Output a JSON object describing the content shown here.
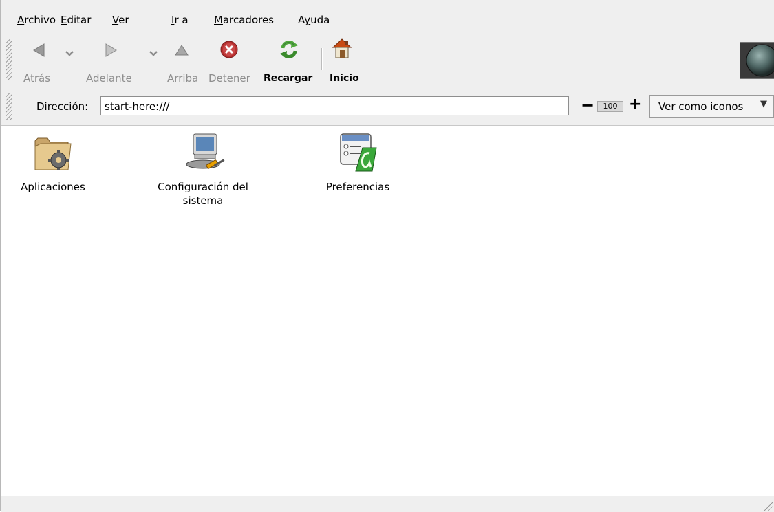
{
  "menubar": {
    "items": [
      {
        "label": "Archivo",
        "mnemonic": "A",
        "rest": "rchivo"
      },
      {
        "label": "Editar",
        "mnemonic": "E",
        "rest": "ditar"
      },
      {
        "label": "Ver",
        "mnemonic": "V",
        "rest": "er"
      },
      {
        "label": "Ir a",
        "mnemonic": "I",
        "rest": "r a"
      },
      {
        "label": "Marcadores",
        "mnemonic": "M",
        "rest": "arcadores"
      },
      {
        "label": "Ayuda",
        "prefix": "A",
        "mnemonic": "y",
        "rest": "uda"
      }
    ]
  },
  "toolbar": {
    "back_label": "Atrás",
    "forward_label": "Adelante",
    "up_label": "Arriba",
    "stop_label": "Detener",
    "reload_label": "Recargar",
    "home_label": "Inicio"
  },
  "location": {
    "label": "Dirección:",
    "value": "start-here:///",
    "zoom_value": "100",
    "zoom_minus": "−",
    "zoom_plus": "+",
    "view_mode": "Ver como iconos",
    "view_mode_arrow": "▼"
  },
  "content": {
    "items": [
      {
        "label": "Aplicaciones",
        "icon": "folder-gear-icon"
      },
      {
        "label": "Configuración del sistema",
        "icon": "system-settings-icon"
      },
      {
        "label": "Preferencias",
        "icon": "preferences-icon"
      }
    ]
  },
  "colors": {
    "chrome": "#efefef",
    "disabled_text": "#8e8e8e",
    "home_roof": "#c84a12",
    "stop_red": "#b83030",
    "reload_green": "#4fa83a"
  }
}
